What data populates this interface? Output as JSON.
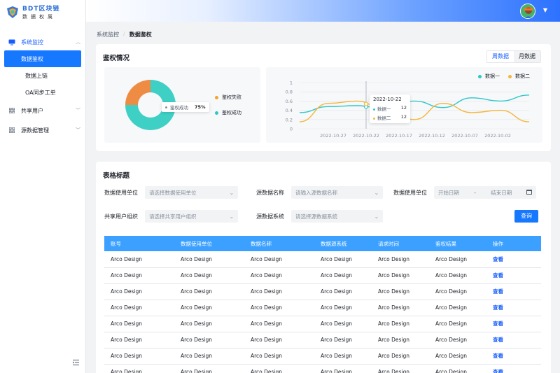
{
  "logo": {
    "title": "BDT区块链",
    "subtitle": "数据权属"
  },
  "sidebar": {
    "groups": [
      {
        "label": "系统监控",
        "icon": "monitor-icon",
        "open": true,
        "items": [
          {
            "label": "数据鉴权",
            "active": true
          },
          {
            "label": "数据上链"
          },
          {
            "label": "OA同步工单"
          }
        ]
      },
      {
        "label": "共享用户",
        "icon": "grid-icon"
      },
      {
        "label": "源数据管理",
        "icon": "grid-icon"
      }
    ]
  },
  "breadcrumb": {
    "parent": "系统监控",
    "separator": "/",
    "current": "数据鉴权"
  },
  "overview": {
    "title": "鉴权情况",
    "segment": {
      "week": "周数据",
      "month": "月数据"
    },
    "tooltip_pie": {
      "label": "鉴权成功",
      "value": "75%"
    },
    "pie_legend": [
      {
        "label": "鉴权失败",
        "color": "#f4a429"
      },
      {
        "label": "鉴权成功",
        "color": "#2ec7c9"
      }
    ]
  },
  "chart_data": [
    {
      "type": "pie",
      "labels": [
        "鉴权成功",
        "鉴权失败"
      ],
      "values": [
        75,
        25
      ],
      "colors": [
        "#3ed0c5",
        "#ee8c44"
      ]
    },
    {
      "type": "line",
      "x": [
        "2022-10-27",
        "2022-10-22",
        "2022-10-17",
        "2022-10-12",
        "2022-10-07",
        "2022-10-02"
      ],
      "ylim": [
        0,
        1
      ],
      "yticks": [
        "0",
        "0.2",
        "0.4",
        "0.6",
        "0.8",
        "1"
      ],
      "series": [
        {
          "name": "数据一",
          "color": "#2ec7c9",
          "values": [
            0.35,
            0.48,
            0.5,
            0.43,
            0.6,
            0.46,
            0.67,
            0.6,
            0.73
          ]
        },
        {
          "name": "数据二",
          "color": "#f5b63a",
          "values": [
            0.15,
            0.55,
            0.6,
            0.4,
            0.2,
            0.55,
            0.35,
            0.4,
            0.15
          ]
        }
      ],
      "tooltip": {
        "title": "2022-10-22",
        "rows": [
          {
            "name": "数据一",
            "value": "12"
          },
          {
            "name": "数据二",
            "value": "12"
          }
        ]
      }
    }
  ],
  "table_section": {
    "title": "表格标题",
    "filters": {
      "unit_label": "数据使用单位",
      "unit_placeholder": "请选择数据使用单位",
      "source_name_label": "源数据名称",
      "source_name_placeholder": "请输入源数据名称",
      "date_label": "数据使用单位",
      "date_start": "开始日期",
      "date_sep": "–",
      "date_end": "结束日期",
      "org_label": "共享用户组织",
      "org_placeholder": "请选择共享用户组织",
      "system_label": "源数据系统",
      "system_placeholder": "请选择源数据系统",
      "query": "查询"
    },
    "columns": [
      "账号",
      "数据使用单位",
      "数据名称",
      "数据源系统",
      "请求时间",
      "鉴权结果",
      "操作"
    ],
    "rows": [
      [
        "Arco Design",
        "Arco Design",
        "Arco Design",
        "Arco Design",
        "Arco Design",
        "Arco Design",
        "查看"
      ],
      [
        "Arco Design",
        "Arco Design",
        "Arco Design",
        "Arco Design",
        "Arco Design",
        "Arco Design",
        "查看"
      ],
      [
        "Arco Design",
        "Arco Design",
        "Arco Design",
        "Arco Design",
        "Arco Design",
        "Arco Design",
        "查看"
      ],
      [
        "Arco Design",
        "Arco Design",
        "Arco Design",
        "Arco Design",
        "Arco Design",
        "Arco Design",
        "查看"
      ],
      [
        "Arco Design",
        "Arco Design",
        "Arco Design",
        "Arco Design",
        "Arco Design",
        "Arco Design",
        "查看"
      ],
      [
        "Arco Design",
        "Arco Design",
        "Arco Design",
        "Arco Design",
        "Arco Design",
        "Arco Design",
        "查看"
      ],
      [
        "Arco Design",
        "Arco Design",
        "Arco Design",
        "Arco Design",
        "Arco Design",
        "Arco Design",
        "查看"
      ],
      [
        "Arco Design",
        "Arco Design",
        "Arco Design",
        "Arco Design",
        "Arco Design",
        "Arco Design",
        "查看"
      ]
    ]
  }
}
